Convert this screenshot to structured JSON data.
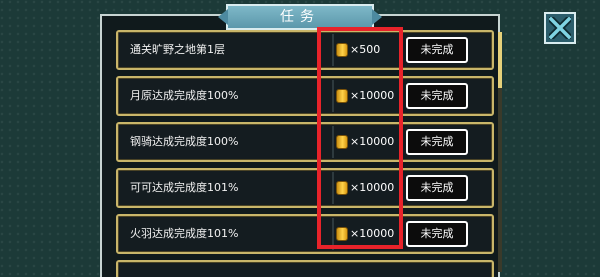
{
  "header": {
    "title": "任务"
  },
  "tasks": [
    {
      "label": "通关旷野之地第1层",
      "reward": "×500",
      "status": "未完成"
    },
    {
      "label": "月原达成完成度100%",
      "reward": "×10000",
      "status": "未完成"
    },
    {
      "label": "钢骑达成完成度100%",
      "reward": "×10000",
      "status": "未完成"
    },
    {
      "label": "可可达成完成度101%",
      "reward": "×10000",
      "status": "未完成"
    },
    {
      "label": "火羽达成完成度101%",
      "reward": "×10000",
      "status": "未完成"
    }
  ],
  "icons": {
    "close": "close-x-icon",
    "reward": "gold-coin-icon"
  },
  "colors": {
    "background": "#1c3a38",
    "panel": "#101a1c",
    "row_border": "#c9b66a",
    "title_tab": "#6aa9bb",
    "highlight": "#e8232a"
  }
}
